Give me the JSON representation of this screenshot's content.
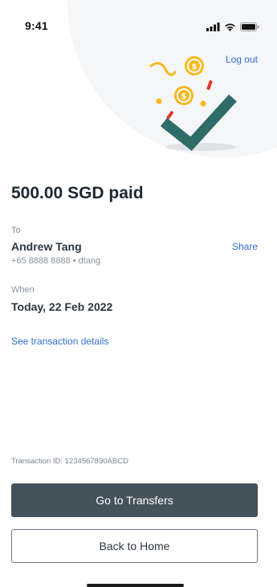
{
  "status_bar": {
    "time": "9:41"
  },
  "header": {
    "logout_label": "Log out"
  },
  "payment": {
    "title": "500.00 SGD paid"
  },
  "recipient": {
    "label": "To",
    "name": "Andrew Tang",
    "details": "+65 8888 8888 • dtang",
    "share_label": "Share"
  },
  "when": {
    "label": "When",
    "value": "Today, 22 Feb 2022"
  },
  "links": {
    "details_label": "See transaction details"
  },
  "transaction": {
    "id_text": "Transaction ID: 1234567890ABCD"
  },
  "buttons": {
    "primary_label": "Go to Transfers",
    "secondary_label": "Back to Home"
  },
  "icons": {
    "signal": "cellular-signal-icon",
    "wifi": "wifi-icon",
    "battery": "battery-icon",
    "illustration": "success-checkmark-coins-illustration"
  },
  "colors": {
    "accent_link": "#2f6fd6",
    "primary_button": "#44525c",
    "checkmark": "#2f6b68",
    "coin": "#f6b81c",
    "confetti_red": "#e5322d"
  }
}
